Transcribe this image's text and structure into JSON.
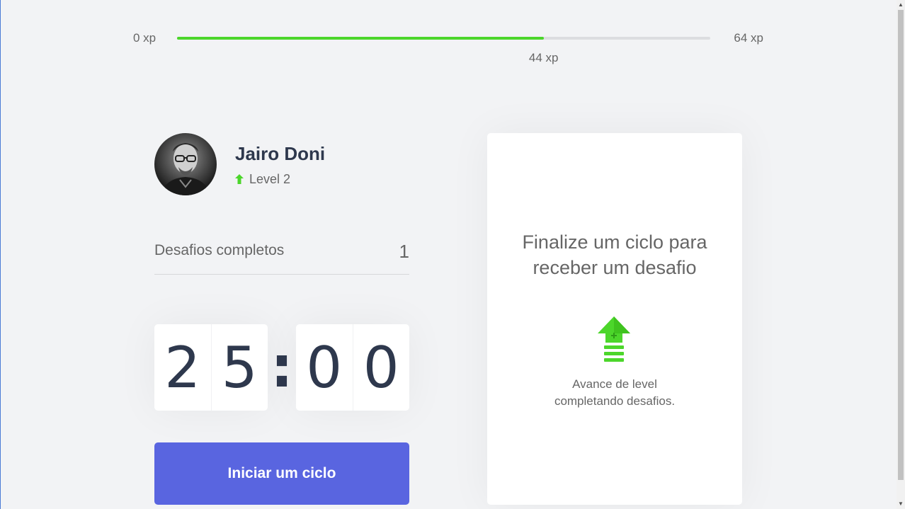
{
  "xp": {
    "min_label": "0 xp",
    "max_label": "64 xp",
    "current_label": "44 xp",
    "progress_fraction": 0.6875
  },
  "profile": {
    "name": "Jairo Doni",
    "level_label": "Level 2"
  },
  "challenges": {
    "completed_label": "Desafios completos",
    "completed_count": "1"
  },
  "countdown": {
    "minutes": [
      "2",
      "5"
    ],
    "separator": ":",
    "seconds": [
      "0",
      "0"
    ]
  },
  "start_button": {
    "label": "Iniciar um ciclo"
  },
  "challenge_box": {
    "title": "Finalize um ciclo para receber um desafio",
    "hint": "Avance de level completando desafios.",
    "icon": "level-up-icon"
  },
  "colors": {
    "accent_green": "#4cd62b",
    "button_blue": "#5965e0",
    "title_dark": "#2e384d",
    "text_gray": "#666666",
    "background": "#f2f3f5"
  }
}
